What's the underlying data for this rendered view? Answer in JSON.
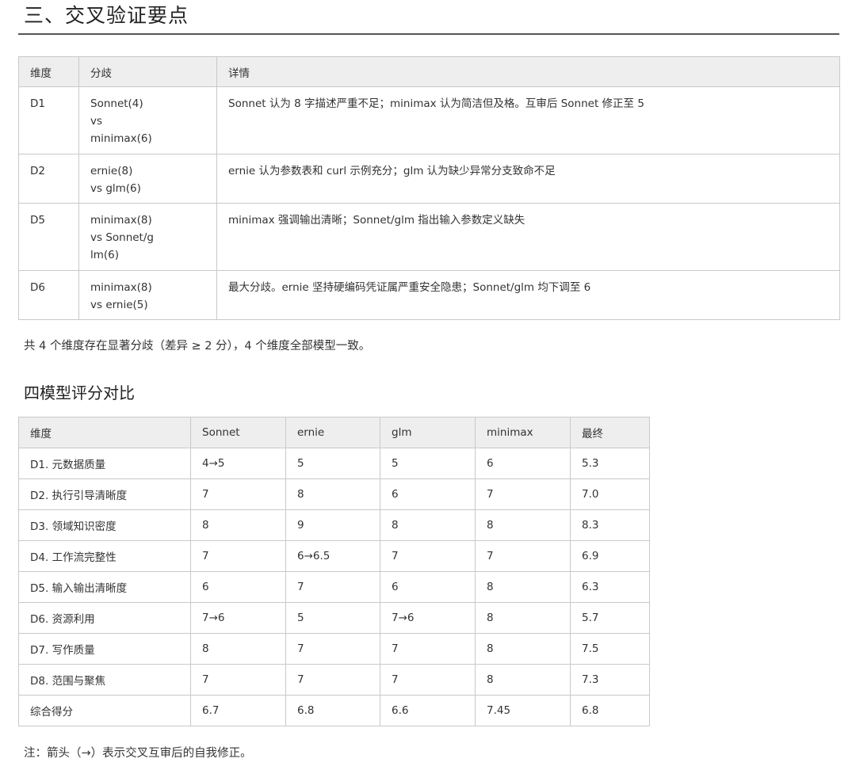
{
  "section_title": "三、交叉验证要点",
  "divergence_table": {
    "headers": [
      "维度",
      "分歧",
      "详情"
    ],
    "rows": [
      {
        "dim": "D1",
        "divergence": [
          "Sonnet(4)",
          "vs",
          "minimax(6)"
        ],
        "detail": "Sonnet 认为 8 字描述严重不足；minimax 认为简洁但及格。互审后 Sonnet 修正至 5"
      },
      {
        "dim": "D2",
        "divergence": [
          "ernie(8)",
          "vs glm(6)"
        ],
        "detail": "ernie 认为参数表和 curl 示例充分；glm 认为缺少异常分支致命不足"
      },
      {
        "dim": "D5",
        "divergence": [
          "minimax(8)",
          "vs Sonnet/g",
          "lm(6)"
        ],
        "detail": "minimax 强调输出清晰；Sonnet/glm 指出输入参数定义缺失"
      },
      {
        "dim": "D6",
        "divergence": [
          "minimax(8)",
          "vs ernie(5)"
        ],
        "detail": "最大分歧。ernie 坚持硬编码凭证属严重安全隐患；Sonnet/glm 均下调至 6"
      }
    ]
  },
  "summary_text": "共 4 个维度存在显著分歧（差异 ≥ 2 分），4 个维度全部模型一致。",
  "comparison_title": "四模型评分对比",
  "score_table": {
    "headers": [
      "维度",
      "Sonnet",
      "ernie",
      "glm",
      "minimax",
      "最终"
    ],
    "rows": [
      [
        "D1. 元数据质量",
        "4→5",
        "5",
        "5",
        "6",
        "5.3"
      ],
      [
        "D2. 执行引导清晰度",
        "7",
        "8",
        "6",
        "7",
        "7.0"
      ],
      [
        "D3. 领域知识密度",
        "8",
        "9",
        "8",
        "8",
        "8.3"
      ],
      [
        "D4. 工作流完整性",
        "7",
        "6→6.5",
        "7",
        "7",
        "6.9"
      ],
      [
        "D5. 输入输出清晰度",
        "6",
        "7",
        "6",
        "8",
        "6.3"
      ],
      [
        "D6. 资源利用",
        "7→6",
        "5",
        "7→6",
        "8",
        "5.7"
      ],
      [
        "D7. 写作质量",
        "8",
        "7",
        "7",
        "8",
        "7.5"
      ],
      [
        "D8. 范围与聚焦",
        "7",
        "7",
        "7",
        "8",
        "7.3"
      ],
      [
        "综合得分",
        "6.7",
        "6.8",
        "6.6",
        "7.45",
        "6.8"
      ]
    ]
  },
  "note_text": "注：箭头（→）表示交叉互审后的自我修正。"
}
